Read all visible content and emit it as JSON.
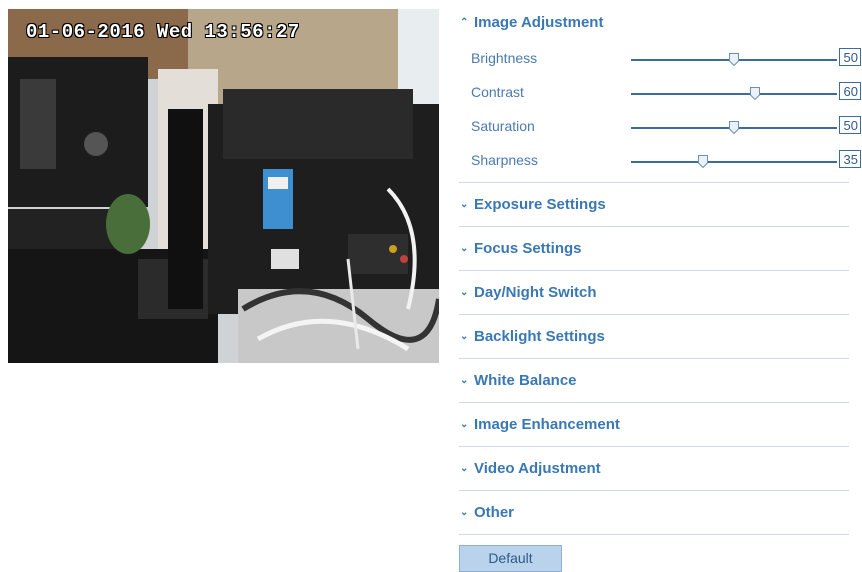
{
  "video": {
    "osd_timestamp": "01-06-2016 Wed 13:56:27"
  },
  "panel": {
    "image_adjustment": {
      "title": "Image Adjustment",
      "expanded": true,
      "sliders": [
        {
          "label": "Brightness",
          "value": "50",
          "min": 0,
          "max": 100
        },
        {
          "label": "Contrast",
          "value": "60",
          "min": 0,
          "max": 100
        },
        {
          "label": "Saturation",
          "value": "50",
          "min": 0,
          "max": 100
        },
        {
          "label": "Sharpness",
          "value": "35",
          "min": 0,
          "max": 100
        }
      ]
    },
    "sections": [
      {
        "title": "Exposure Settings"
      },
      {
        "title": "Focus Settings"
      },
      {
        "title": "Day/Night Switch"
      },
      {
        "title": "Backlight Settings"
      },
      {
        "title": "White Balance"
      },
      {
        "title": "Image Enhancement"
      },
      {
        "title": "Video Adjustment"
      },
      {
        "title": "Other"
      }
    ],
    "default_button": "Default"
  },
  "colors": {
    "accent": "#3a78b4",
    "track": "#3b6c9f",
    "divider": "#cfd9e6",
    "button_bg": "#b9d3ec"
  }
}
